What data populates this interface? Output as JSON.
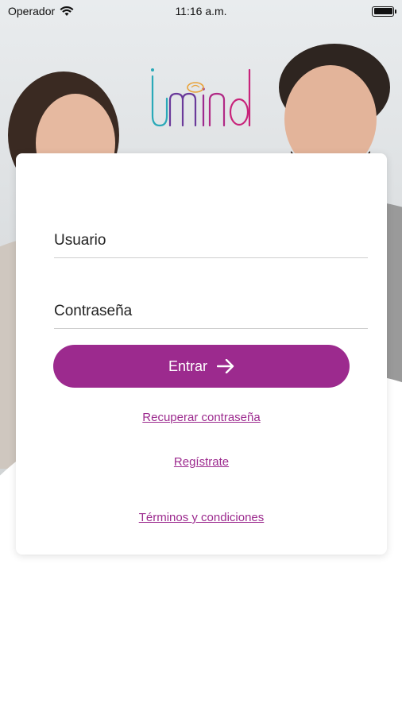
{
  "status_bar": {
    "carrier": "Operador",
    "time": "11:16 a.m."
  },
  "brand": {
    "logo_text": "imind",
    "accent_color": "#9c2a8e",
    "logo_colors": [
      "#2aa9b8",
      "#9c2a8e",
      "#e8a33a"
    ]
  },
  "login": {
    "username_placeholder": "Usuario",
    "password_placeholder": "Contraseña",
    "submit_label": "Entrar",
    "recover_label": "Recuperar contraseña",
    "register_label": "Regístrate",
    "terms_label": "Términos y condiciones"
  },
  "icons": {
    "wifi": "wifi-icon",
    "battery": "battery-icon",
    "submit_arrow": "arrow-right-icon"
  }
}
